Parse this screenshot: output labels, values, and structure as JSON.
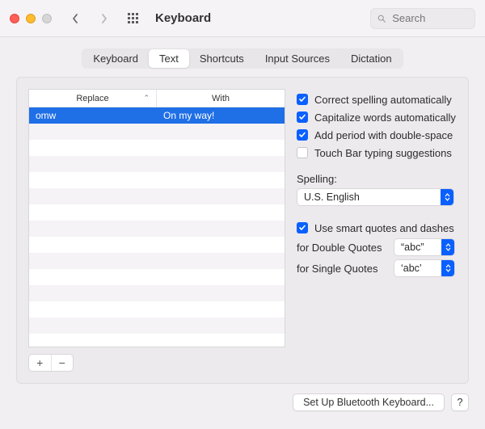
{
  "window": {
    "title": "Keyboard",
    "search_placeholder": "Search"
  },
  "tabs": {
    "keyboard": "Keyboard",
    "text": "Text",
    "shortcuts": "Shortcuts",
    "input_sources": "Input Sources",
    "dictation": "Dictation"
  },
  "table": {
    "col_replace": "Replace",
    "col_with": "With",
    "rows": [
      {
        "replace": "omw",
        "with": "On my way!"
      }
    ],
    "add_label": "+",
    "remove_label": "−"
  },
  "options": {
    "correct_spelling": "Correct spelling automatically",
    "capitalize": "Capitalize words automatically",
    "double_space_period": "Add period with double-space",
    "touch_bar": "Touch Bar typing suggestions",
    "spelling_label": "Spelling:",
    "spelling_value": "U.S. English",
    "smart_quotes": "Use smart quotes and dashes",
    "double_quotes_label": "for Double Quotes",
    "double_quotes_value": "“abc”",
    "single_quotes_label": "for Single Quotes",
    "single_quotes_value": "‘abc’"
  },
  "footer": {
    "bluetooth": "Set Up Bluetooth Keyboard...",
    "help": "?"
  }
}
